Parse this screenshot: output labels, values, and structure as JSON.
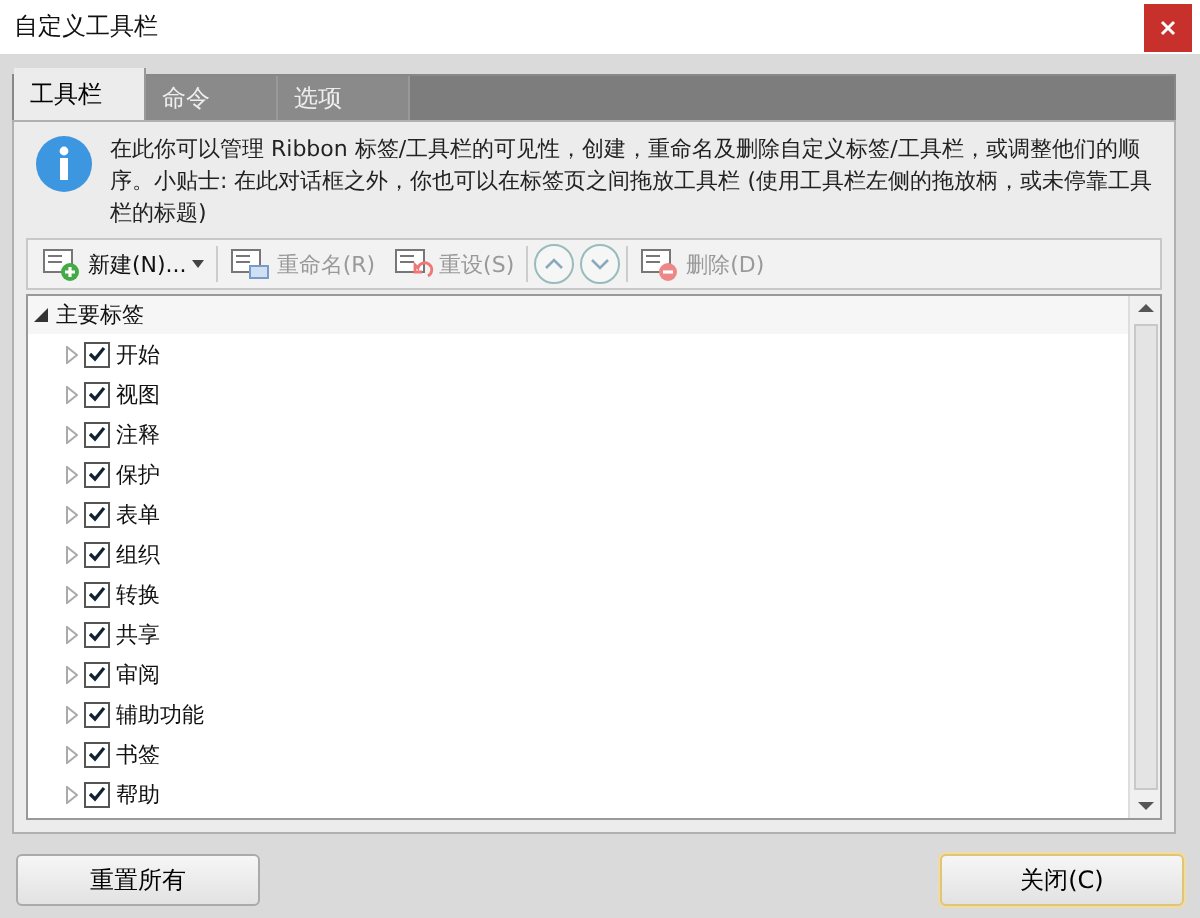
{
  "window": {
    "title": "自定义工具栏"
  },
  "tabs": [
    {
      "label": "工具栏",
      "selected": true
    },
    {
      "label": "命令",
      "selected": false
    },
    {
      "label": "选项",
      "selected": false
    }
  ],
  "info": "在此你可以管理 Ribbon 标签/工具栏的可见性，创建，重命名及删除自定义标签/工具栏，或调整他们的顺序。小贴士: 在此对话框之外，你也可以在标签页之间拖放工具栏 (使用工具栏左侧的拖放柄，或未停靠工具栏的标题)",
  "toolbar": [
    {
      "kind": "new",
      "label": "新建(N)...",
      "disabled": false
    },
    {
      "kind": "rename",
      "label": "重命名(R)",
      "disabled": true
    },
    {
      "kind": "reset",
      "label": "重设(S)",
      "disabled": true
    },
    {
      "kind": "up",
      "disabled": true
    },
    {
      "kind": "down",
      "disabled": true
    },
    {
      "kind": "delete",
      "label": "删除(D)",
      "disabled": true
    }
  ],
  "tree": {
    "label": "主要标签",
    "expanded": true,
    "children": [
      {
        "label": "开始",
        "checked": true
      },
      {
        "label": "视图",
        "checked": true
      },
      {
        "label": "注释",
        "checked": true
      },
      {
        "label": "保护",
        "checked": true
      },
      {
        "label": "表单",
        "checked": true
      },
      {
        "label": "组织",
        "checked": true
      },
      {
        "label": "转换",
        "checked": true
      },
      {
        "label": "共享",
        "checked": true
      },
      {
        "label": "审阅",
        "checked": true
      },
      {
        "label": "辅助功能",
        "checked": true
      },
      {
        "label": "书签",
        "checked": true
      },
      {
        "label": "帮助",
        "checked": true
      }
    ]
  },
  "buttons": [
    {
      "label": "重置所有",
      "focused": false
    },
    {
      "label": "关闭(C)",
      "focused": true
    }
  ]
}
